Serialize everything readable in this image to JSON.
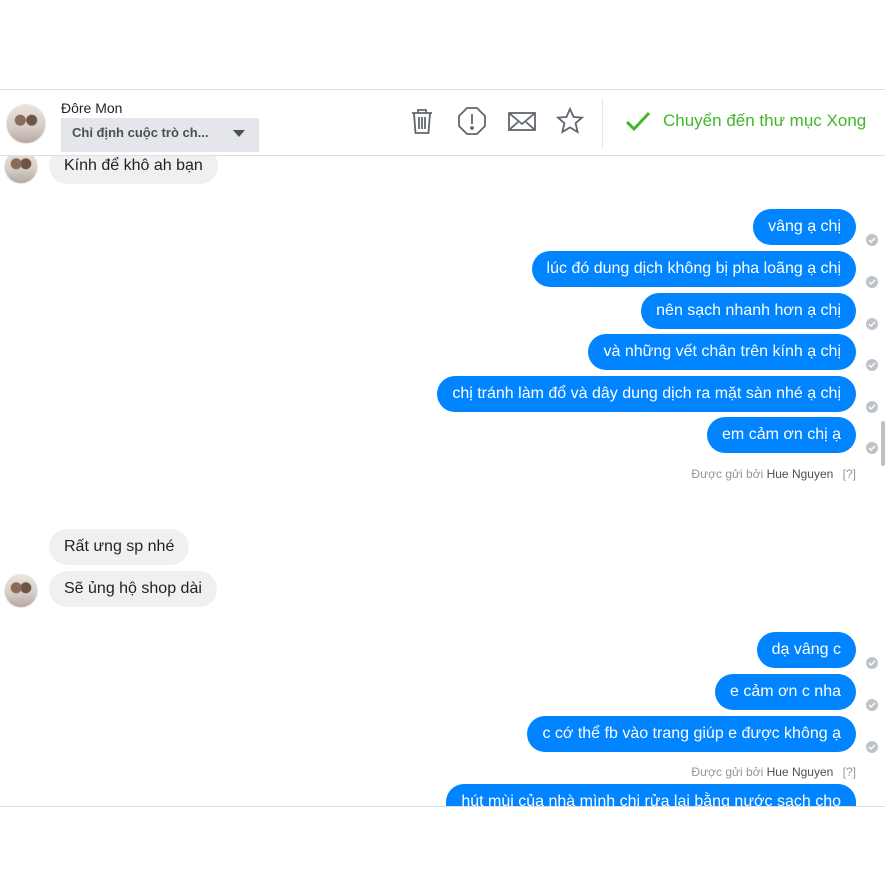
{
  "header": {
    "contact_name": "Đôre Mon",
    "assign_label": "Chỉ định cuộc trò ch...",
    "done_label": "Chuyển đến thư mục Xong",
    "accent_color": "#42b72a"
  },
  "icons": [
    "trash-icon",
    "report-icon",
    "envelope-icon",
    "star-icon",
    "checkmark-icon"
  ],
  "messages": {
    "m0": "Kính để khô ah bạn",
    "m1": "vâng ạ chị",
    "m2": "lúc đó dung dịch không bị pha loãng ạ chị",
    "m3": "nên sạch nhanh hơn ạ chị",
    "m4": "và những vết chân trên kính ạ chị",
    "m5": "chị tránh làm đổ và dây dung dịch ra mặt sàn nhé ạ chị",
    "m6": "em cảm ơn chị ạ",
    "m7": "Rất ưng sp nhé",
    "m8": "Sẽ ủng hộ shop dài",
    "m9": "dạ vâng c",
    "m10": "e cảm ơn c nha",
    "m11": "c cớ thể fb vào trang giúp e được không ạ",
    "m12": "hút mùi của nhà mình chị rửa lại bằng nước sạch cho"
  },
  "sent_by": {
    "prefix": "Được gửi bởi",
    "name": "Hue Nguyen",
    "help": "[?]"
  },
  "colors": {
    "outgoing_bubble": "#0084ff",
    "incoming_bubble": "#f1f0f0"
  }
}
